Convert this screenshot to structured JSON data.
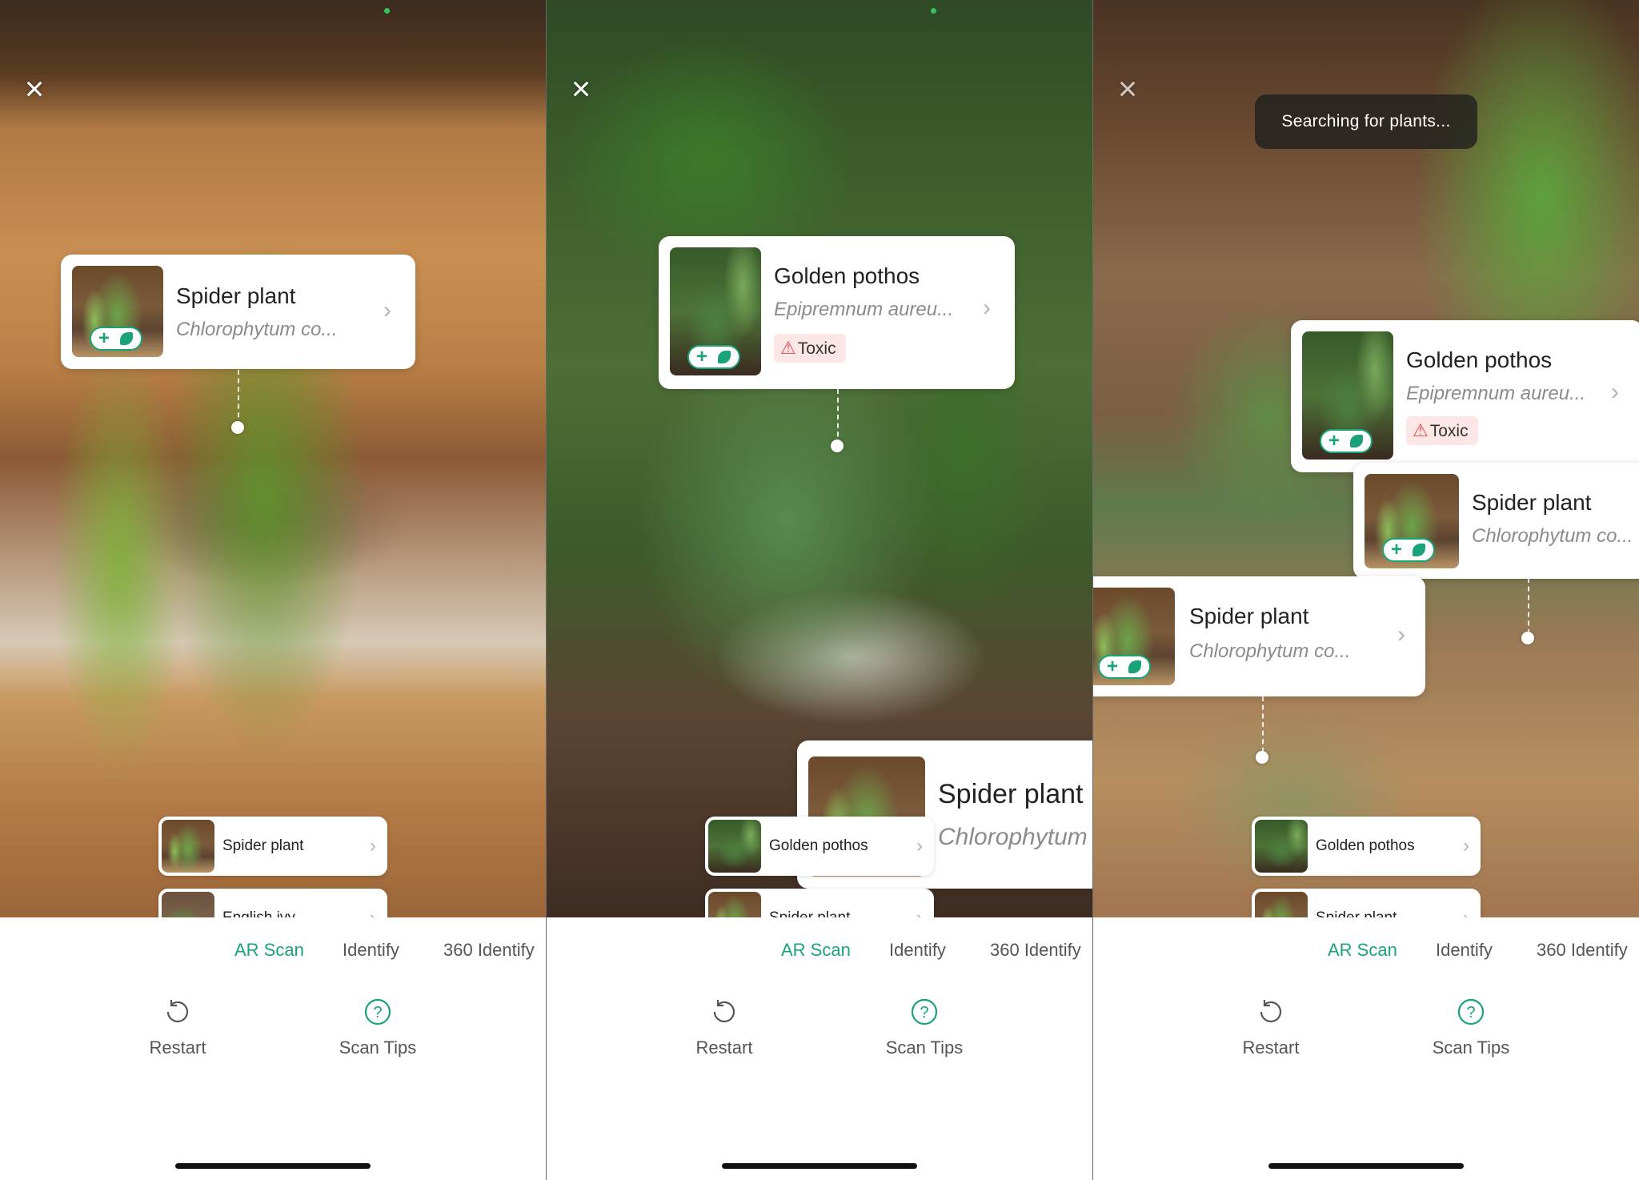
{
  "panels": [
    {
      "toast": "",
      "ar_labels": [
        {
          "name": "Spider plant",
          "scientific": "Chlorophytum co...",
          "toxic": ""
        }
      ],
      "results": [
        {
          "label": "Spider plant"
        },
        {
          "label": "English ivy"
        }
      ]
    },
    {
      "toast": "",
      "ar_labels": [
        {
          "name": "Golden pothos",
          "scientific": "Epipremnum aureu...",
          "toxic": "Toxic"
        },
        {
          "name": "Spider plant",
          "scientific": "Chlorophytum",
          "toxic": ""
        }
      ],
      "results": [
        {
          "label": "Golden pothos"
        },
        {
          "label": "Spider plant"
        }
      ]
    },
    {
      "toast": "Searching for plants...",
      "ar_labels": [
        {
          "name": "Golden pothos",
          "scientific": "Epipremnum aureu...",
          "toxic": "Toxic"
        },
        {
          "name": "Spider plant",
          "scientific": "Chlorophytum co...",
          "toxic": ""
        },
        {
          "name": "Spider plant",
          "scientific": "Chlorophytum co...",
          "toxic": ""
        }
      ],
      "results": [
        {
          "label": "Golden pothos"
        },
        {
          "label": "Spider plant"
        }
      ]
    }
  ],
  "tabs": [
    "AR Scan",
    "Identify",
    "360 Identify"
  ],
  "actions": {
    "restart": "Restart",
    "scan_tips": "Scan Tips"
  },
  "icons": {
    "close": "close-icon",
    "add": "add-plant-icon",
    "chevron": "chevron-right-icon",
    "warning": "warning-icon",
    "restart": "restart-icon",
    "help": "help-circle-icon"
  },
  "colors": {
    "accent": "#1aa37a",
    "toxic_bg": "#fde6e6",
    "toxic_icon": "#e14646",
    "camera_dot": "#37c15f"
  }
}
